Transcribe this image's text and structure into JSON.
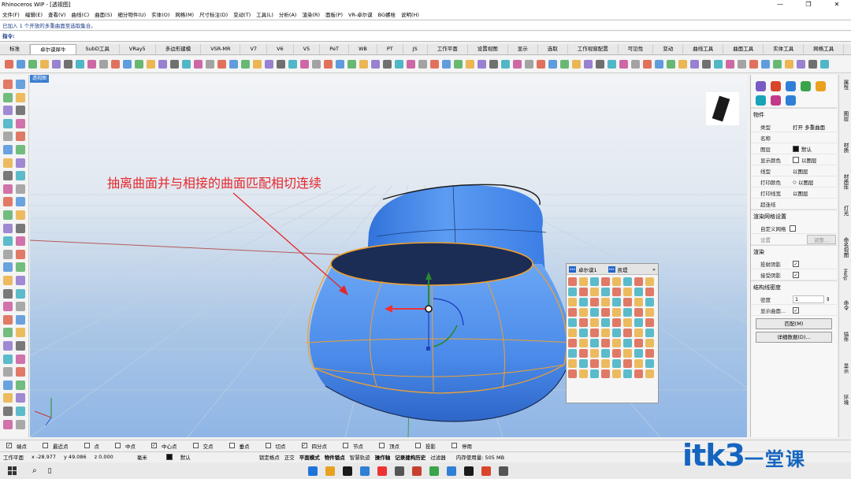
{
  "window": {
    "title": "Rhinoceros WIP - [透视图]",
    "controls": [
      "—",
      "❐",
      "✕"
    ]
  },
  "menu": [
    "文件(F)",
    "编辑(E)",
    "查看(V)",
    "曲线(C)",
    "曲面(S)",
    "细分物件(U)",
    "实体(O)",
    "网格(M)",
    "尺寸标注(D)",
    "变动(T)",
    "工具(L)",
    "分析(A)",
    "渲染(R)",
    "面板(P)",
    "VR-卓尔谟",
    "BG螺栓",
    "说明(H)"
  ],
  "command": {
    "history": "已加入 1 个开放的多重曲面至选取集合。",
    "prompt": "指令:"
  },
  "tabs": [
    "标准",
    "卓尔谟犀牛",
    "SubD工具",
    "VRay5",
    "多边形建模",
    "VSR-MR",
    "V7",
    "V6",
    "V5",
    "PeT",
    "WB",
    "PT",
    "JS",
    "工作平面",
    "设置视图",
    "显示",
    "选取",
    "工作视窗配置",
    "可见性",
    "变动",
    "曲线工具",
    "曲面工具",
    "实体工具",
    "网格工具",
    "渲染"
  ],
  "active_tab": 1,
  "viewport": {
    "label": "透视图",
    "annotation": "抽离曲面并与相接的曲面匹配相切连续"
  },
  "float_panel": {
    "tab1": "卓尔谟1",
    "tab2": "凯堤",
    "badge": "xxx",
    "more": "»"
  },
  "properties": {
    "section_object": "物件",
    "rows": [
      {
        "key": "类型",
        "value": "打开 多重曲面"
      },
      {
        "key": "名称",
        "value": ""
      },
      {
        "key": "图层",
        "value": "默认"
      },
      {
        "key": "显示颜色",
        "value": "以图层"
      },
      {
        "key": "线型",
        "value": "以图层"
      },
      {
        "key": "打印颜色",
        "value": "以图层"
      },
      {
        "key": "打印线宽",
        "value": "以图层"
      },
      {
        "key": "超连结",
        "value": ""
      }
    ],
    "section_mesh": "渲染网格设置",
    "custom_mesh": "自定义网格",
    "settings": "设置",
    "adjust": "调整...",
    "section_render": "渲染",
    "cast_shadows": "投射阴影",
    "receive_shadows": "接受阴影",
    "section_isocurve": "结构线密度",
    "density_label": "密度",
    "density_value": "1",
    "show_surface": "显示曲面...",
    "match_btn": "匹配(M)",
    "details_btn": "详细数据(D)..."
  },
  "side_tabs": [
    "属性",
    "图层",
    "材质",
    "材质库",
    "灯光",
    "命名视图",
    "Help",
    "命令",
    "插件",
    "显示",
    "环境"
  ],
  "osnap": [
    {
      "label": "端点",
      "checked": true
    },
    {
      "label": "最近点",
      "checked": false
    },
    {
      "label": "点",
      "checked": false
    },
    {
      "label": "中点",
      "checked": false
    },
    {
      "label": "中心点",
      "checked": true
    },
    {
      "label": "交点",
      "checked": false
    },
    {
      "label": "垂点",
      "checked": false
    },
    {
      "label": "切点",
      "checked": false
    },
    {
      "label": "四分点",
      "checked": true
    },
    {
      "label": "节点",
      "checked": false
    },
    {
      "label": "顶点",
      "checked": false
    },
    {
      "label": "投影",
      "checked": false
    },
    {
      "label": "停用",
      "checked": false
    }
  ],
  "status": {
    "cplane": "工作平面",
    "x": "x -28.977",
    "y": "y 49.086",
    "z": "z 0.000",
    "unit": "毫米",
    "layer": "默认",
    "toggles": [
      "锁定格点",
      "正交",
      "平面模式",
      "物件锁点",
      "智慧轨迹",
      "操作轴",
      "记录建构历史",
      "过滤器"
    ],
    "memory": "内存使用量: 505 MB"
  },
  "watermark": {
    "text": "itk3",
    "cn": "一堂课",
    "dotcom": ".com"
  },
  "colors": {
    "accent": "#3b7fd1",
    "annotation": "#e5262b",
    "object": "#4d8ff0",
    "edge": "#f0a030"
  }
}
